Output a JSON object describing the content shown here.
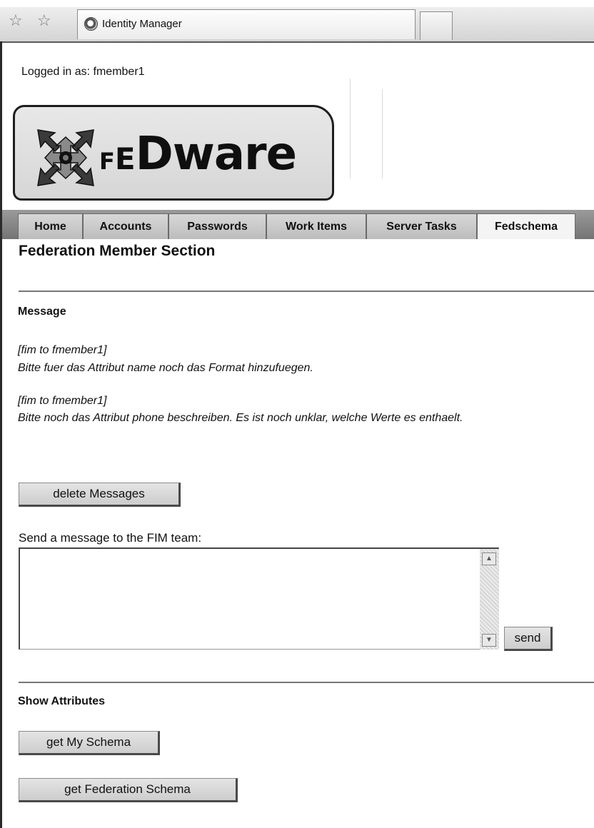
{
  "browser": {
    "tab_title": "Identity Manager",
    "favorites_icon": "star-outline-icon",
    "add_favorites_icon": "star-add-icon"
  },
  "header": {
    "logged_in_text": "Logged in as: fmember1",
    "logo_text_small": "F",
    "logo_text_small_2": "E",
    "logo_text_big": "Dware"
  },
  "nav": {
    "tabs": [
      {
        "label": "Home"
      },
      {
        "label": "Accounts"
      },
      {
        "label": "Passwords"
      },
      {
        "label": "Work Items"
      },
      {
        "label": "Server Tasks"
      },
      {
        "label": "Fedschema"
      }
    ],
    "active_tab": "Fedschema"
  },
  "main": {
    "section_title": "Federation Member Section",
    "message_heading": "Message",
    "messages": [
      {
        "from": "[fim to fmember1]",
        "text": "Bitte fuer das Attribut name noch das Format hinzufuegen."
      },
      {
        "from": "[fim to fmember1]",
        "text": "Bitte noch das Attribut phone beschreiben. Es ist noch unklar, welche Werte es enthaelt."
      }
    ],
    "delete_button": "delete Messages",
    "send_prompt": "Send a message to the FIM team:",
    "message_input_value": "",
    "send_button": "send",
    "attributes_heading": "Show Attributes",
    "my_schema_button": "get My Schema",
    "federation_schema_button": "get Federation Schema"
  }
}
